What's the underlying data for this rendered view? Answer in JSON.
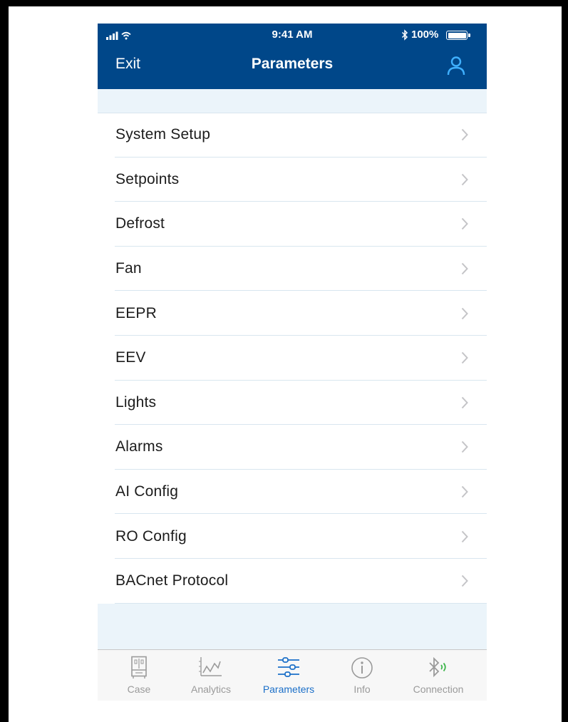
{
  "status_bar": {
    "time": "9:41 AM",
    "battery": "100%",
    "signal_icon": "signal-wifi-icon",
    "bluetooth_icon": "bluetooth-icon",
    "battery_icon": "battery-icon"
  },
  "nav": {
    "back_label": "Exit",
    "title": "Parameters",
    "user_icon": "user-icon",
    "background": "#004789"
  },
  "menu": {
    "items": [
      {
        "label": "System Setup"
      },
      {
        "label": "Setpoints"
      },
      {
        "label": "Defrost"
      },
      {
        "label": "Fan"
      },
      {
        "label": "EEPR"
      },
      {
        "label": "EEV"
      },
      {
        "label": "Lights"
      },
      {
        "label": "Alarms"
      },
      {
        "label": "AI Config"
      },
      {
        "label": "RO Config"
      },
      {
        "label": "BACnet Protocol"
      }
    ],
    "chevron_icon": "chevron-right-icon"
  },
  "tabbar": {
    "tabs": [
      {
        "label": "Case",
        "icon": "case-icon",
        "active": false
      },
      {
        "label": "Analytics",
        "icon": "analytics-chart-icon",
        "active": false
      },
      {
        "label": "Parameters",
        "icon": "sliders-icon",
        "active": true
      },
      {
        "label": "Info",
        "icon": "info-icon",
        "active": false
      },
      {
        "label": "Connection",
        "icon": "bluetooth-connection-icon",
        "active": false
      }
    ],
    "active_color": "#1b6fc8",
    "inactive_color": "#9a9a9a"
  }
}
